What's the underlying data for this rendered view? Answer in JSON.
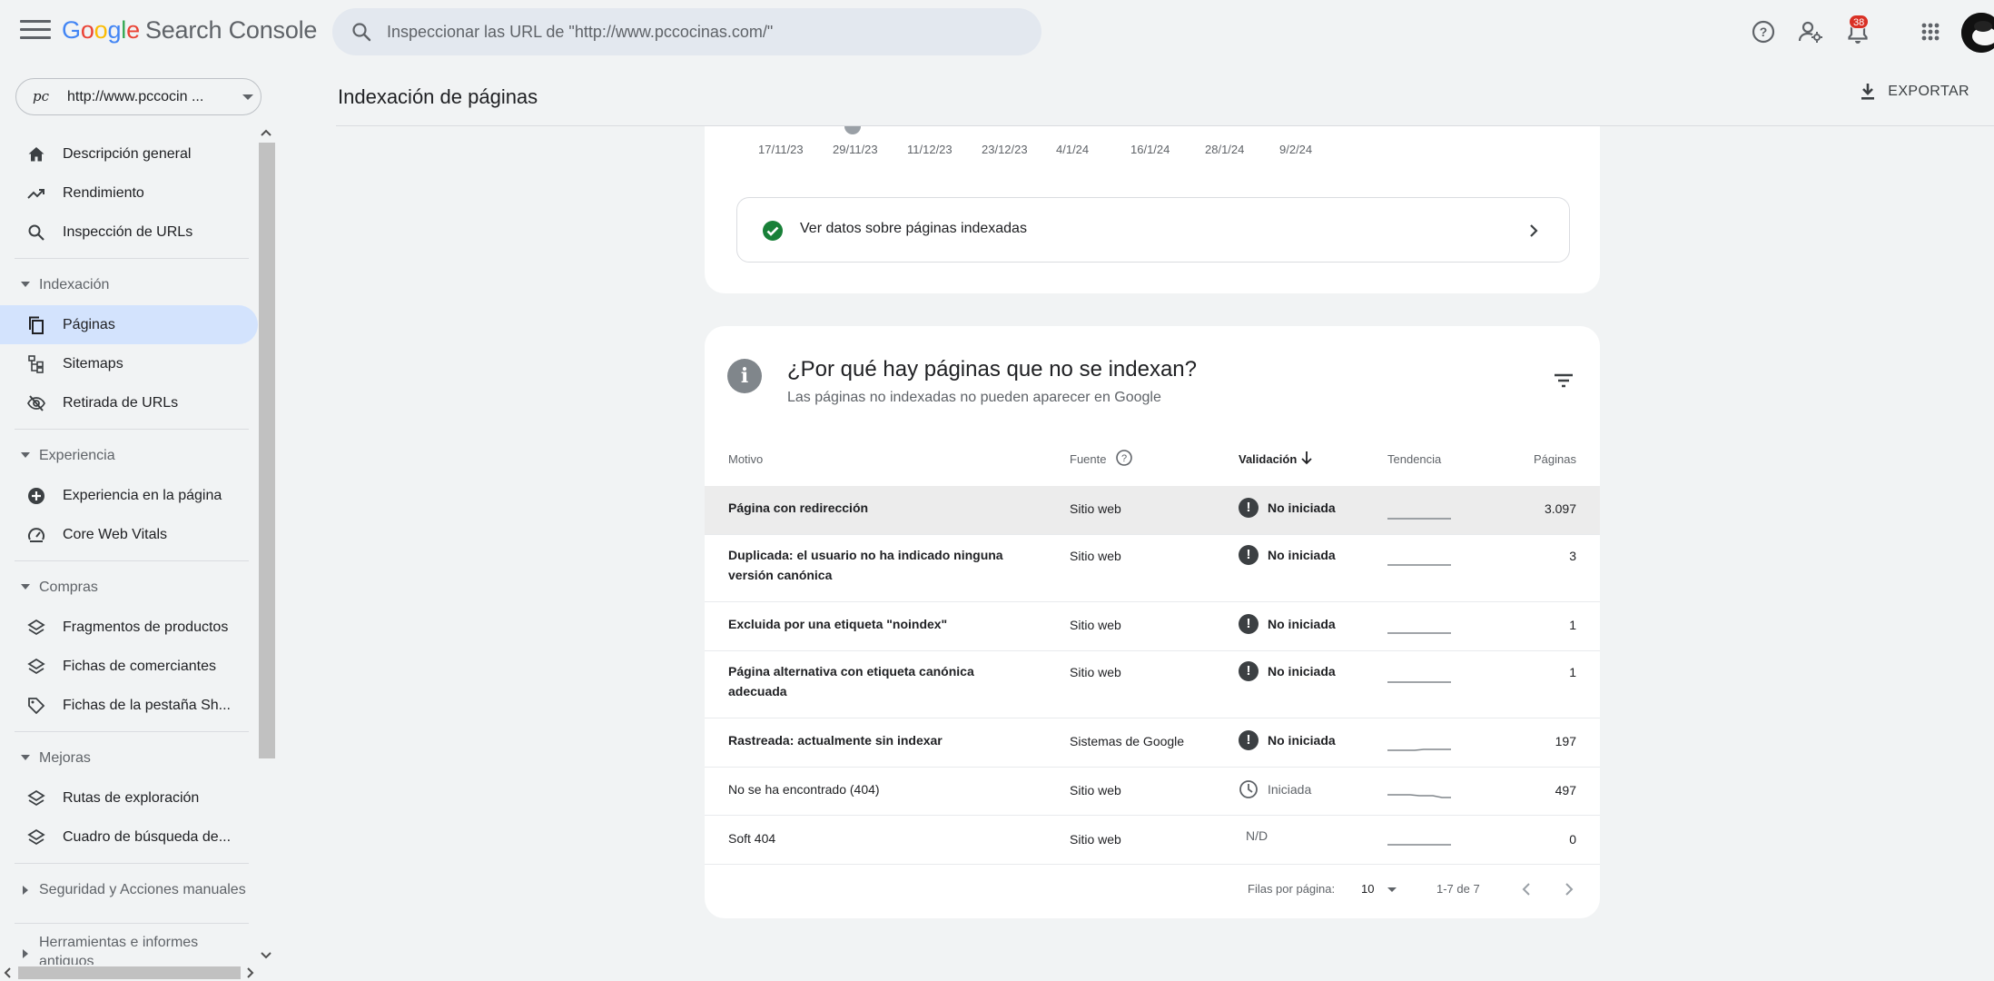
{
  "header": {
    "logo_google": "Google",
    "logo_product": "Search Console",
    "search_placeholder": "Inspeccionar las URL de \"http://www.pccocinas.com/\"",
    "notifications_count": "38"
  },
  "property": {
    "favicon_text": "pc",
    "label": "http://www.pccocin ..."
  },
  "page": {
    "title": "Indexación de páginas",
    "export_label": "EXPORTAR"
  },
  "sidebar": {
    "items_top": [
      {
        "label": "Descripción general",
        "icon": "home-icon"
      },
      {
        "label": "Rendimiento",
        "icon": "trending-up-icon"
      },
      {
        "label": "Inspección de URLs",
        "icon": "search-icon"
      }
    ],
    "sections": [
      {
        "label": "Indexación",
        "expanded": true,
        "items": [
          {
            "label": "Páginas",
            "icon": "pages-icon",
            "active": true
          },
          {
            "label": "Sitemaps",
            "icon": "sitemap-icon"
          },
          {
            "label": "Retirada de URLs",
            "icon": "eye-off-icon"
          }
        ]
      },
      {
        "label": "Experiencia",
        "expanded": true,
        "items": [
          {
            "label": "Experiencia en la página",
            "icon": "plus-circle-icon"
          },
          {
            "label": "Core Web Vitals",
            "icon": "speed-icon"
          }
        ]
      },
      {
        "label": "Compras",
        "expanded": true,
        "items": [
          {
            "label": "Fragmentos de productos",
            "icon": "layers-icon"
          },
          {
            "label": "Fichas de comerciantes",
            "icon": "layers-icon"
          },
          {
            "label": "Fichas de la pestaña Sh...",
            "icon": "tag-icon"
          }
        ]
      },
      {
        "label": "Mejoras",
        "expanded": true,
        "items": [
          {
            "label": "Rutas de exploración",
            "icon": "layers-icon"
          },
          {
            "label": "Cuadro de búsqueda de...",
            "icon": "layers-icon"
          }
        ]
      },
      {
        "label": "Seguridad y Acciones manuales",
        "expanded": false,
        "items": []
      },
      {
        "label": "Herramientas e informes antiguos",
        "expanded": false,
        "items": []
      }
    ]
  },
  "chart_axis": {
    "ticks": [
      "17/11/23",
      "29/11/23",
      "11/12/23",
      "23/12/23",
      "4/1/24",
      "16/1/24",
      "28/1/24",
      "9/2/24"
    ]
  },
  "indexed_link": {
    "label": "Ver datos sobre páginas indexadas"
  },
  "why": {
    "title": "¿Por qué hay páginas que no se indexan?",
    "subtitle": "Las páginas no indexadas no pueden aparecer en Google",
    "columns": {
      "motivo": "Motivo",
      "fuente": "Fuente",
      "validacion": "Validación",
      "tendencia": "Tendencia",
      "paginas": "Páginas"
    },
    "rows": [
      {
        "motivo": "Página con redirección",
        "fuente": "Sitio web",
        "validacion": "No iniciada",
        "status": "not-started",
        "paginas": "3.097"
      },
      {
        "motivo": "Duplicada: el usuario no ha indicado ninguna versión canónica",
        "fuente": "Sitio web",
        "validacion": "No iniciada",
        "status": "not-started",
        "paginas": "3"
      },
      {
        "motivo": "Excluida por una etiqueta \"noindex\"",
        "fuente": "Sitio web",
        "validacion": "No iniciada",
        "status": "not-started",
        "paginas": "1"
      },
      {
        "motivo": "Página alternativa con etiqueta canónica adecuada",
        "fuente": "Sitio web",
        "validacion": "No iniciada",
        "status": "not-started",
        "paginas": "1"
      },
      {
        "motivo": "Rastreada: actualmente sin indexar",
        "fuente": "Sistemas de Google",
        "validacion": "No iniciada",
        "status": "not-started",
        "paginas": "197"
      },
      {
        "motivo": "No se ha encontrado (404)",
        "fuente": "Sitio web",
        "validacion": "Iniciada",
        "status": "started",
        "paginas": "497"
      },
      {
        "motivo": "Soft 404",
        "fuente": "Sitio web",
        "validacion": "N/D",
        "status": "na",
        "paginas": "0"
      }
    ],
    "pager": {
      "rows_label": "Filas por página:",
      "rows_value": "10",
      "range": "1-7 de 7"
    }
  },
  "colors": {
    "accent_blue": "#1a73e8",
    "active_bg": "#d3e3fd",
    "success_green": "#188038",
    "badge_red": "#d93025"
  }
}
